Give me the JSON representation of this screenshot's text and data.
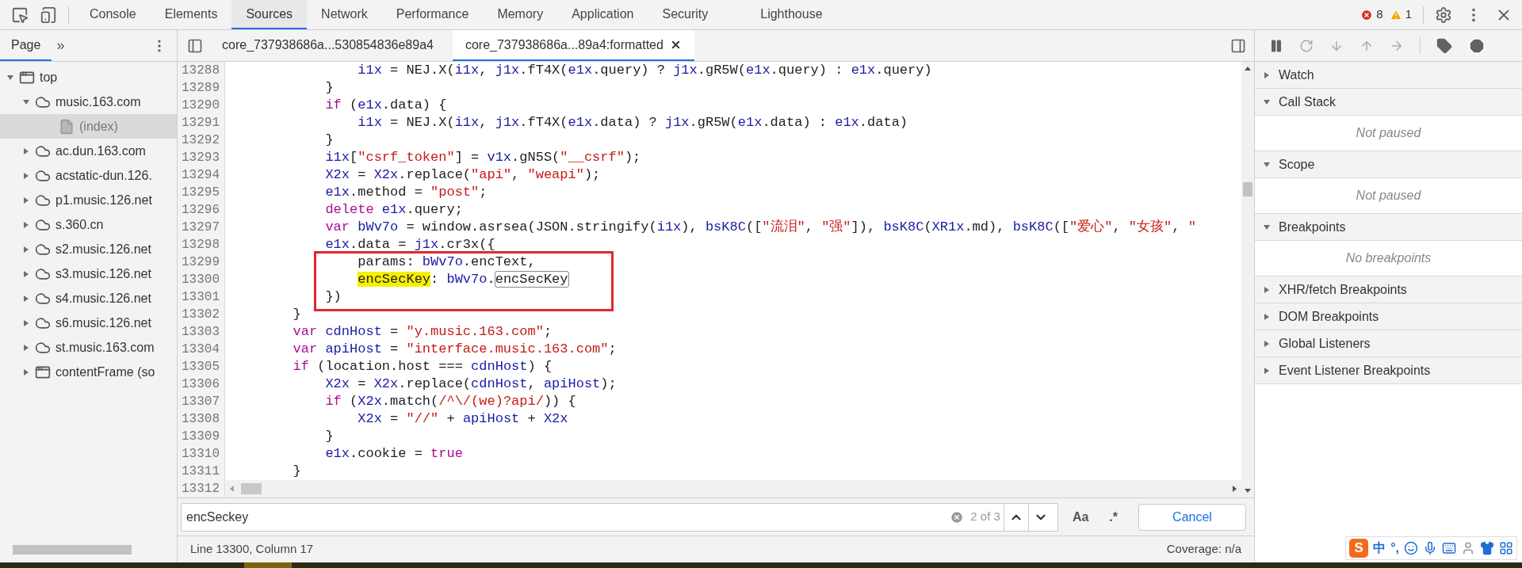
{
  "top_tabs": [
    {
      "label": "Console",
      "selected": false
    },
    {
      "label": "Elements",
      "selected": false
    },
    {
      "label": "Sources",
      "selected": true
    },
    {
      "label": "Network",
      "selected": false
    },
    {
      "label": "Performance",
      "selected": false
    },
    {
      "label": "Memory",
      "selected": false
    },
    {
      "label": "Application",
      "selected": false
    },
    {
      "label": "Security",
      "selected": false
    },
    {
      "label": "Lighthouse",
      "selected": false
    }
  ],
  "issues": {
    "errors": "8",
    "warnings": "1"
  },
  "navigator": {
    "tabs": [
      {
        "label": "Page",
        "selected": true
      }
    ],
    "more": "»",
    "tree": [
      {
        "label": "top",
        "kind": "frame",
        "expanded": true,
        "selected": false,
        "children": [
          {
            "label": "music.163.com",
            "kind": "domain",
            "expanded": true,
            "selected": false,
            "children": [
              {
                "label": "(index)",
                "kind": "file",
                "selected": true
              }
            ]
          },
          {
            "label": "ac.dun.163.com",
            "kind": "domain",
            "expanded": false,
            "selected": false
          },
          {
            "label": "acstatic-dun.126.",
            "kind": "domain",
            "expanded": false,
            "selected": false
          },
          {
            "label": "p1.music.126.net",
            "kind": "domain",
            "expanded": false,
            "selected": false
          },
          {
            "label": "s.360.cn",
            "kind": "domain",
            "expanded": false,
            "selected": false
          },
          {
            "label": "s2.music.126.net",
            "kind": "domain",
            "expanded": false,
            "selected": false
          },
          {
            "label": "s3.music.126.net",
            "kind": "domain",
            "expanded": false,
            "selected": false
          },
          {
            "label": "s4.music.126.net",
            "kind": "domain",
            "expanded": false,
            "selected": false
          },
          {
            "label": "s6.music.126.net",
            "kind": "domain",
            "expanded": false,
            "selected": false
          },
          {
            "label": "st.music.163.com",
            "kind": "domain",
            "expanded": false,
            "selected": false
          },
          {
            "label": "contentFrame (so",
            "kind": "frame",
            "expanded": false,
            "selected": false
          }
        ]
      }
    ]
  },
  "editor_tabs": [
    {
      "label": "core_737938686a...530854836e89a4",
      "selected": false,
      "closable": false
    },
    {
      "label": "core_737938686a...89a4:formatted",
      "selected": true,
      "closable": true
    }
  ],
  "code": [
    {
      "number": "13288",
      "boxed": false,
      "tokens": [
        {
          "kind": "var",
          "text": "                i1x"
        },
        {
          "kind": "plain",
          "text": " = NEJ.X("
        },
        {
          "kind": "var",
          "text": "i1x"
        },
        {
          "kind": "plain",
          "text": ", "
        },
        {
          "kind": "var",
          "text": "j1x"
        },
        {
          "kind": "plain",
          "text": ".fT4X("
        },
        {
          "kind": "var",
          "text": "e1x"
        },
        {
          "kind": "plain",
          "text": ".query) ? "
        },
        {
          "kind": "var",
          "text": "j1x"
        },
        {
          "kind": "plain",
          "text": ".gR5W("
        },
        {
          "kind": "var",
          "text": "e1x"
        },
        {
          "kind": "plain",
          "text": ".query) : "
        },
        {
          "kind": "var",
          "text": "e1x"
        },
        {
          "kind": "plain",
          "text": ".query)"
        }
      ]
    },
    {
      "number": "13289",
      "boxed": false,
      "tokens": [
        {
          "kind": "plain",
          "text": "            }"
        }
      ]
    },
    {
      "number": "13290",
      "boxed": false,
      "tokens": [
        {
          "kind": "keyword",
          "text": "            if"
        },
        {
          "kind": "plain",
          "text": " ("
        },
        {
          "kind": "var",
          "text": "e1x"
        },
        {
          "kind": "plain",
          "text": ".data) {"
        }
      ]
    },
    {
      "number": "13291",
      "boxed": false,
      "tokens": [
        {
          "kind": "var",
          "text": "                i1x"
        },
        {
          "kind": "plain",
          "text": " = NEJ.X("
        },
        {
          "kind": "var",
          "text": "i1x"
        },
        {
          "kind": "plain",
          "text": ", "
        },
        {
          "kind": "var",
          "text": "j1x"
        },
        {
          "kind": "plain",
          "text": ".fT4X("
        },
        {
          "kind": "var",
          "text": "e1x"
        },
        {
          "kind": "plain",
          "text": ".data) ? "
        },
        {
          "kind": "var",
          "text": "j1x"
        },
        {
          "kind": "plain",
          "text": ".gR5W("
        },
        {
          "kind": "var",
          "text": "e1x"
        },
        {
          "kind": "plain",
          "text": ".data) : "
        },
        {
          "kind": "var",
          "text": "e1x"
        },
        {
          "kind": "plain",
          "text": ".data)"
        }
      ]
    },
    {
      "number": "13292",
      "boxed": false,
      "tokens": [
        {
          "kind": "plain",
          "text": "            }"
        }
      ]
    },
    {
      "number": "13293",
      "boxed": false,
      "tokens": [
        {
          "kind": "var",
          "text": "            i1x"
        },
        {
          "kind": "plain",
          "text": "["
        },
        {
          "kind": "string",
          "text": "\"csrf_token\""
        },
        {
          "kind": "plain",
          "text": "] = "
        },
        {
          "kind": "var",
          "text": "v1x"
        },
        {
          "kind": "plain",
          "text": ".gN5S("
        },
        {
          "kind": "string",
          "text": "\"__csrf\""
        },
        {
          "kind": "plain",
          "text": ");"
        }
      ]
    },
    {
      "number": "13294",
      "boxed": false,
      "tokens": [
        {
          "kind": "var",
          "text": "            X2x"
        },
        {
          "kind": "plain",
          "text": " = "
        },
        {
          "kind": "var",
          "text": "X2x"
        },
        {
          "kind": "plain",
          "text": ".replace("
        },
        {
          "kind": "string",
          "text": "\"api\""
        },
        {
          "kind": "plain",
          "text": ", "
        },
        {
          "kind": "string",
          "text": "\"weapi\""
        },
        {
          "kind": "plain",
          "text": ");"
        }
      ]
    },
    {
      "number": "13295",
      "boxed": false,
      "tokens": [
        {
          "kind": "var",
          "text": "            e1x"
        },
        {
          "kind": "plain",
          "text": ".method = "
        },
        {
          "kind": "string",
          "text": "\"post\""
        },
        {
          "kind": "plain",
          "text": ";"
        }
      ]
    },
    {
      "number": "13296",
      "boxed": false,
      "tokens": [
        {
          "kind": "keyword",
          "text": "            delete "
        },
        {
          "kind": "var",
          "text": "e1x"
        },
        {
          "kind": "plain",
          "text": ".query;"
        }
      ]
    },
    {
      "number": "13297",
      "boxed": false,
      "tokens": [
        {
          "kind": "keyword",
          "text": "            var "
        },
        {
          "kind": "var",
          "text": "bWv7o"
        },
        {
          "kind": "plain",
          "text": " = window.asrsea(JSON.stringify("
        },
        {
          "kind": "var",
          "text": "i1x"
        },
        {
          "kind": "plain",
          "text": "), "
        },
        {
          "kind": "var",
          "text": "bsK8C"
        },
        {
          "kind": "plain",
          "text": "(["
        },
        {
          "kind": "string",
          "text": "\"流泪\""
        },
        {
          "kind": "plain",
          "text": ", "
        },
        {
          "kind": "string",
          "text": "\"强\""
        },
        {
          "kind": "plain",
          "text": "]), "
        },
        {
          "kind": "var",
          "text": "bsK8C"
        },
        {
          "kind": "plain",
          "text": "("
        },
        {
          "kind": "var",
          "text": "XR1x"
        },
        {
          "kind": "plain",
          "text": ".md), "
        },
        {
          "kind": "var",
          "text": "bsK8C"
        },
        {
          "kind": "plain",
          "text": "(["
        },
        {
          "kind": "string",
          "text": "\"爱心\""
        },
        {
          "kind": "plain",
          "text": ", "
        },
        {
          "kind": "string",
          "text": "\"女孩\""
        },
        {
          "kind": "plain",
          "text": ", "
        },
        {
          "kind": "string",
          "text": "\""
        }
      ]
    },
    {
      "number": "13298",
      "boxed": false,
      "tokens": [
        {
          "kind": "var",
          "text": "            e1x"
        },
        {
          "kind": "plain",
          "text": ".data = "
        },
        {
          "kind": "var",
          "text": "j1x"
        },
        {
          "kind": "plain",
          "text": ".cr3x({"
        }
      ]
    },
    {
      "number": "13299",
      "boxed": true,
      "tokens": [
        {
          "kind": "plain",
          "text": "                params: "
        },
        {
          "kind": "var",
          "text": "bWv7o"
        },
        {
          "kind": "plain",
          "text": ".encText,"
        }
      ]
    },
    {
      "number": "13300",
      "boxed": true,
      "tokens": [
        {
          "kind": "current_match",
          "text": "encSecKey"
        },
        {
          "kind": "plain",
          "text": ": "
        },
        {
          "kind": "var",
          "text": "bWv7o"
        },
        {
          "kind": "plain",
          "text": "."
        },
        {
          "kind": "match",
          "text": "encSecKey"
        }
      ]
    },
    {
      "number": "13301",
      "boxed": true,
      "tokens": [
        {
          "kind": "plain",
          "text": "            })"
        }
      ]
    },
    {
      "number": "13302",
      "boxed": false,
      "tokens": [
        {
          "kind": "plain",
          "text": "        }"
        }
      ]
    },
    {
      "number": "13303",
      "boxed": false,
      "tokens": [
        {
          "kind": "keyword",
          "text": "        var "
        },
        {
          "kind": "var",
          "text": "cdnHost"
        },
        {
          "kind": "plain",
          "text": " = "
        },
        {
          "kind": "string",
          "text": "\"y.music.163.com\""
        },
        {
          "kind": "plain",
          "text": ";"
        }
      ]
    },
    {
      "number": "13304",
      "boxed": false,
      "tokens": [
        {
          "kind": "keyword",
          "text": "        var "
        },
        {
          "kind": "var",
          "text": "apiHost"
        },
        {
          "kind": "plain",
          "text": " = "
        },
        {
          "kind": "string",
          "text": "\"interface.music.163.com\""
        },
        {
          "kind": "plain",
          "text": ";"
        }
      ]
    },
    {
      "number": "13305",
      "boxed": false,
      "tokens": [
        {
          "kind": "keyword",
          "text": "        if"
        },
        {
          "kind": "plain",
          "text": " (location.host === "
        },
        {
          "kind": "var",
          "text": "cdnHost"
        },
        {
          "kind": "plain",
          "text": ") {"
        }
      ]
    },
    {
      "number": "13306",
      "boxed": false,
      "tokens": [
        {
          "kind": "var",
          "text": "            X2x"
        },
        {
          "kind": "plain",
          "text": " = "
        },
        {
          "kind": "var",
          "text": "X2x"
        },
        {
          "kind": "plain",
          "text": ".replace("
        },
        {
          "kind": "var",
          "text": "cdnHost"
        },
        {
          "kind": "plain",
          "text": ", "
        },
        {
          "kind": "var",
          "text": "apiHost"
        },
        {
          "kind": "plain",
          "text": ");"
        }
      ]
    },
    {
      "number": "13307",
      "boxed": false,
      "tokens": [
        {
          "kind": "keyword",
          "text": "            if"
        },
        {
          "kind": "plain",
          "text": " ("
        },
        {
          "kind": "var",
          "text": "X2x"
        },
        {
          "kind": "plain",
          "text": ".match("
        },
        {
          "kind": "string",
          "text": "/^\\/(we)?api/"
        },
        {
          "kind": "plain",
          "text": ")) {"
        }
      ]
    },
    {
      "number": "13308",
      "boxed": false,
      "tokens": [
        {
          "kind": "var",
          "text": "                X2x"
        },
        {
          "kind": "plain",
          "text": " = "
        },
        {
          "kind": "string",
          "text": "\"//\""
        },
        {
          "kind": "plain",
          "text": " + "
        },
        {
          "kind": "var",
          "text": "apiHost"
        },
        {
          "kind": "plain",
          "text": " + "
        },
        {
          "kind": "var",
          "text": "X2x"
        }
      ]
    },
    {
      "number": "13309",
      "boxed": false,
      "tokens": [
        {
          "kind": "plain",
          "text": "            }"
        }
      ]
    },
    {
      "number": "13310",
      "boxed": false,
      "tokens": [
        {
          "kind": "var",
          "text": "            e1x"
        },
        {
          "kind": "plain",
          "text": ".cookie = "
        },
        {
          "kind": "keyword",
          "text": "true"
        }
      ]
    },
    {
      "number": "13311",
      "boxed": false,
      "tokens": [
        {
          "kind": "plain",
          "text": "        }"
        }
      ]
    },
    {
      "number": "13312"
    }
  ],
  "search": {
    "value": "encSeckey",
    "count": "2 of 3",
    "case_button": "Aa",
    "regex_button": ".*",
    "cancel": "Cancel"
  },
  "status_bar": {
    "position": "Line 13300, Column 17",
    "coverage": "Coverage: n/a"
  },
  "debugger": {
    "sections": [
      {
        "title": "Watch",
        "expanded": false
      },
      {
        "title": "Call Stack",
        "expanded": true,
        "message": "Not paused"
      },
      {
        "title": "Scope",
        "expanded": true,
        "message": "Not paused"
      },
      {
        "title": "Breakpoints",
        "expanded": true,
        "message": "No breakpoints"
      },
      {
        "title": "XHR/fetch Breakpoints",
        "expanded": false
      },
      {
        "title": "DOM Breakpoints",
        "expanded": false
      },
      {
        "title": "Global Listeners",
        "expanded": false
      },
      {
        "title": "Event Listener Breakpoints",
        "expanded": false
      }
    ]
  },
  "ime_toolbar": {
    "logo": "S",
    "mode": "中",
    "punctuation": "°,"
  }
}
